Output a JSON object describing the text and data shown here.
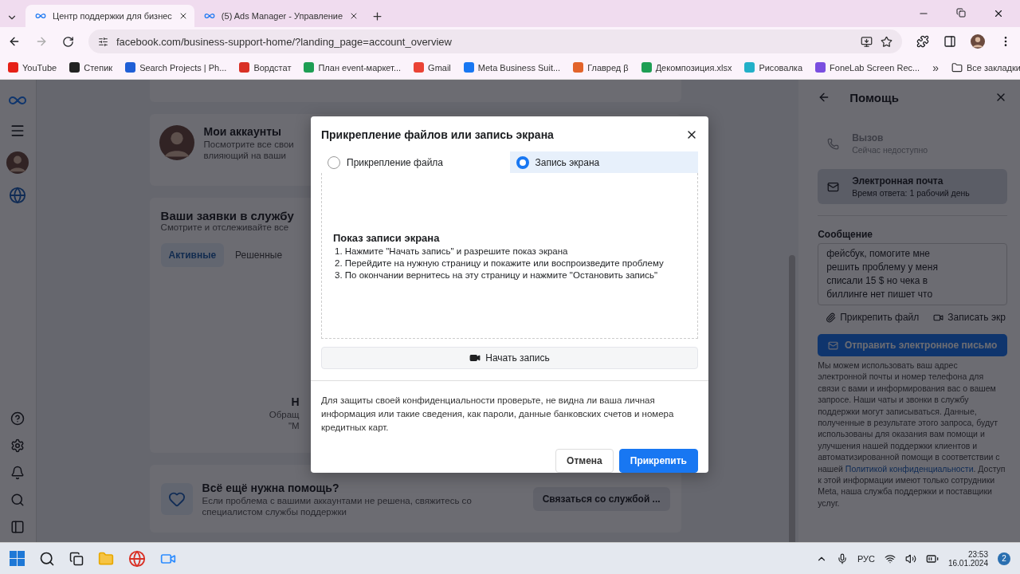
{
  "browser": {
    "tabs": [
      {
        "title": "Центр поддержки для бизнес",
        "selected": true
      },
      {
        "title": "(5) Ads Manager - Управление",
        "selected": false
      }
    ],
    "address": "facebook.com/business-support-home/?landing_page=account_overview",
    "bookmarks": [
      {
        "label": "YouTube",
        "color": "#e62117"
      },
      {
        "label": "Степик",
        "color": "#222222"
      },
      {
        "label": "Search Projects | Ph...",
        "color": "#1f5fd6"
      },
      {
        "label": "Вордстат",
        "color": "#d93025"
      },
      {
        "label": "План event-маркет...",
        "color": "#1e9e54"
      },
      {
        "label": "Gmail",
        "color": "#ea4335"
      },
      {
        "label": "Meta Business Suit...",
        "color": "#1877f2"
      },
      {
        "label": "Главред β",
        "color": "#e2632a"
      },
      {
        "label": "Декомпозиция.xlsx",
        "color": "#1e9e54"
      },
      {
        "label": "Рисовалка",
        "color": "#22b0c8"
      },
      {
        "label": "FoneLab Screen Rec...",
        "color": "#7a4ee0"
      }
    ],
    "more": "»",
    "all_bookmarks": "Все закладки"
  },
  "page": {
    "accounts": {
      "title": "Мои аккаунты",
      "lines": [
        "Посмотрите все свои",
        "влияющий на ваши"
      ]
    },
    "requests": {
      "title": "Ваши заявки в службу",
      "subtitle": "Смотрите и отслеживайте все",
      "tabs": [
        {
          "label": "Активные",
          "selected": true
        },
        {
          "label": "Решенные",
          "selected": false
        }
      ],
      "empty": {
        "title": "Н",
        "lines": [
          "Обращ",
          "\"М"
        ]
      }
    },
    "help": {
      "title": "Всё ещё нужна помощь?",
      "lines": [
        "Если проблема с вашими аккаунтами не решена, свяжитесь со",
        "специалистом службы поддержки"
      ],
      "button": "Связаться со службой ..."
    }
  },
  "modal": {
    "title": "Прикрепление файлов или запись экрана",
    "options": [
      {
        "label": "Прикрепление файла",
        "selected": false
      },
      {
        "label": "Запись экрана",
        "selected": true
      }
    ],
    "instructions": {
      "title": "Показ записи экрана",
      "steps": [
        "1. Нажмите \"Начать запись\" и разрешите показ экрана",
        "2. Перейдите на нужную страницу и покажите или воспроизведите проблему",
        "3. По окончании вернитесь на эту страницу и нажмите \"Остановить запись\""
      ]
    },
    "record_button": "Начать запись",
    "privacy": "Для защиты своей конфиденциальности проверьте, не видна ли ваша личная информация или такие сведения, как пароли, данные банковских счетов и номера кредитных карт.",
    "buttons": [
      {
        "label": "Отмена",
        "kind": "secondary"
      },
      {
        "label": "Прикрепить",
        "kind": "primary"
      }
    ]
  },
  "help_panel": {
    "title": "Помощь",
    "contacts": [
      {
        "title": "Вызов",
        "subtitle": "Сейчас недоступно",
        "selected": false
      },
      {
        "title": "Электронная почта",
        "subtitle": "Время ответа: 1 рабочий день",
        "selected": true
      }
    ],
    "message": {
      "label": "Сообщение",
      "lines": [
        "фейсбук, помогите мне",
        "решить проблему у меня",
        "списали 15 $ но чека в",
        "биллинге нет пишет что"
      ]
    },
    "attach": [
      "Прикрепить файл",
      "Записать экр"
    ],
    "send": "Отправить электронное письмо",
    "disclaimer": {
      "before": "Мы можем использовать ваш адрес электронной почты и номер телефона для связи с вами и информирования вас о вашем запросе. Наши чаты и звонки в службу поддержки могут записываться. Данные, полученные в результате этого запроса, будут использованы для оказания вам помощи и улучшения нашей поддержки клиентов и автоматизированной помощи в соответствии с нашей ",
      "link": "Политикой конфиденциальности",
      "after": ". Доступ к этой информации имеют только сотрудники Meta, наша служба поддержки и поставщики услуг."
    }
  },
  "taskbar": {
    "language": "РУС",
    "time": "23:53",
    "date": "16.01.2024",
    "badge": "2"
  }
}
